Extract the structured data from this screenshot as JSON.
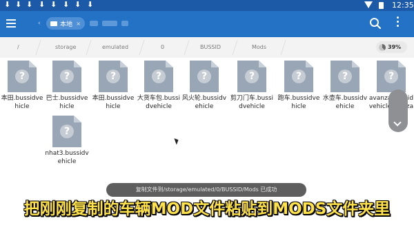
{
  "status_bar": {
    "time": "12:35",
    "download_glyph": "⬇"
  },
  "app_bar": {
    "active_tab": "本地",
    "tab_close": "×",
    "home_chevron": "‹"
  },
  "breadcrumb": {
    "items": [
      "/",
      "storage",
      "emulated",
      "0",
      "BUSSID",
      "Mods"
    ],
    "storage_percent": "39%"
  },
  "files": [
    {
      "name": "本田.bussidvehicle"
    },
    {
      "name": "巴士.bussidvehicle"
    },
    {
      "name": "本田.bussidvehicle"
    },
    {
      "name": "大货车包.bussidvehicle"
    },
    {
      "name": "风火轮.bussidvehicle"
    },
    {
      "name": "剪刀门车.bussidvehicle"
    },
    {
      "name": "跑车.bussidvehicle"
    },
    {
      "name": "水壶车.bussidvehicle"
    },
    {
      "name": "avanza.bussidvehicleavanza"
    },
    {
      "name": "nhat3.bussidvehicle"
    }
  ],
  "file_icon_glyph": "?",
  "toast": "复制文件到/storage/emulated/0/BUSSID/Mods 已成功",
  "subtitle": "把刚刚复制的车辆MOD文件粘贴到MODS文件夹里",
  "colors": {
    "status_bar": "#1c5aa8",
    "app_bar": "#2372c6",
    "subtitle": "#ffe24a"
  },
  "icons": [
    "menu-icon",
    "folder-icon",
    "search-icon",
    "more-vert-icon",
    "storage-pie-icon",
    "file-unknown-icon",
    "chevron-down-icon",
    "cursor-icon"
  ]
}
